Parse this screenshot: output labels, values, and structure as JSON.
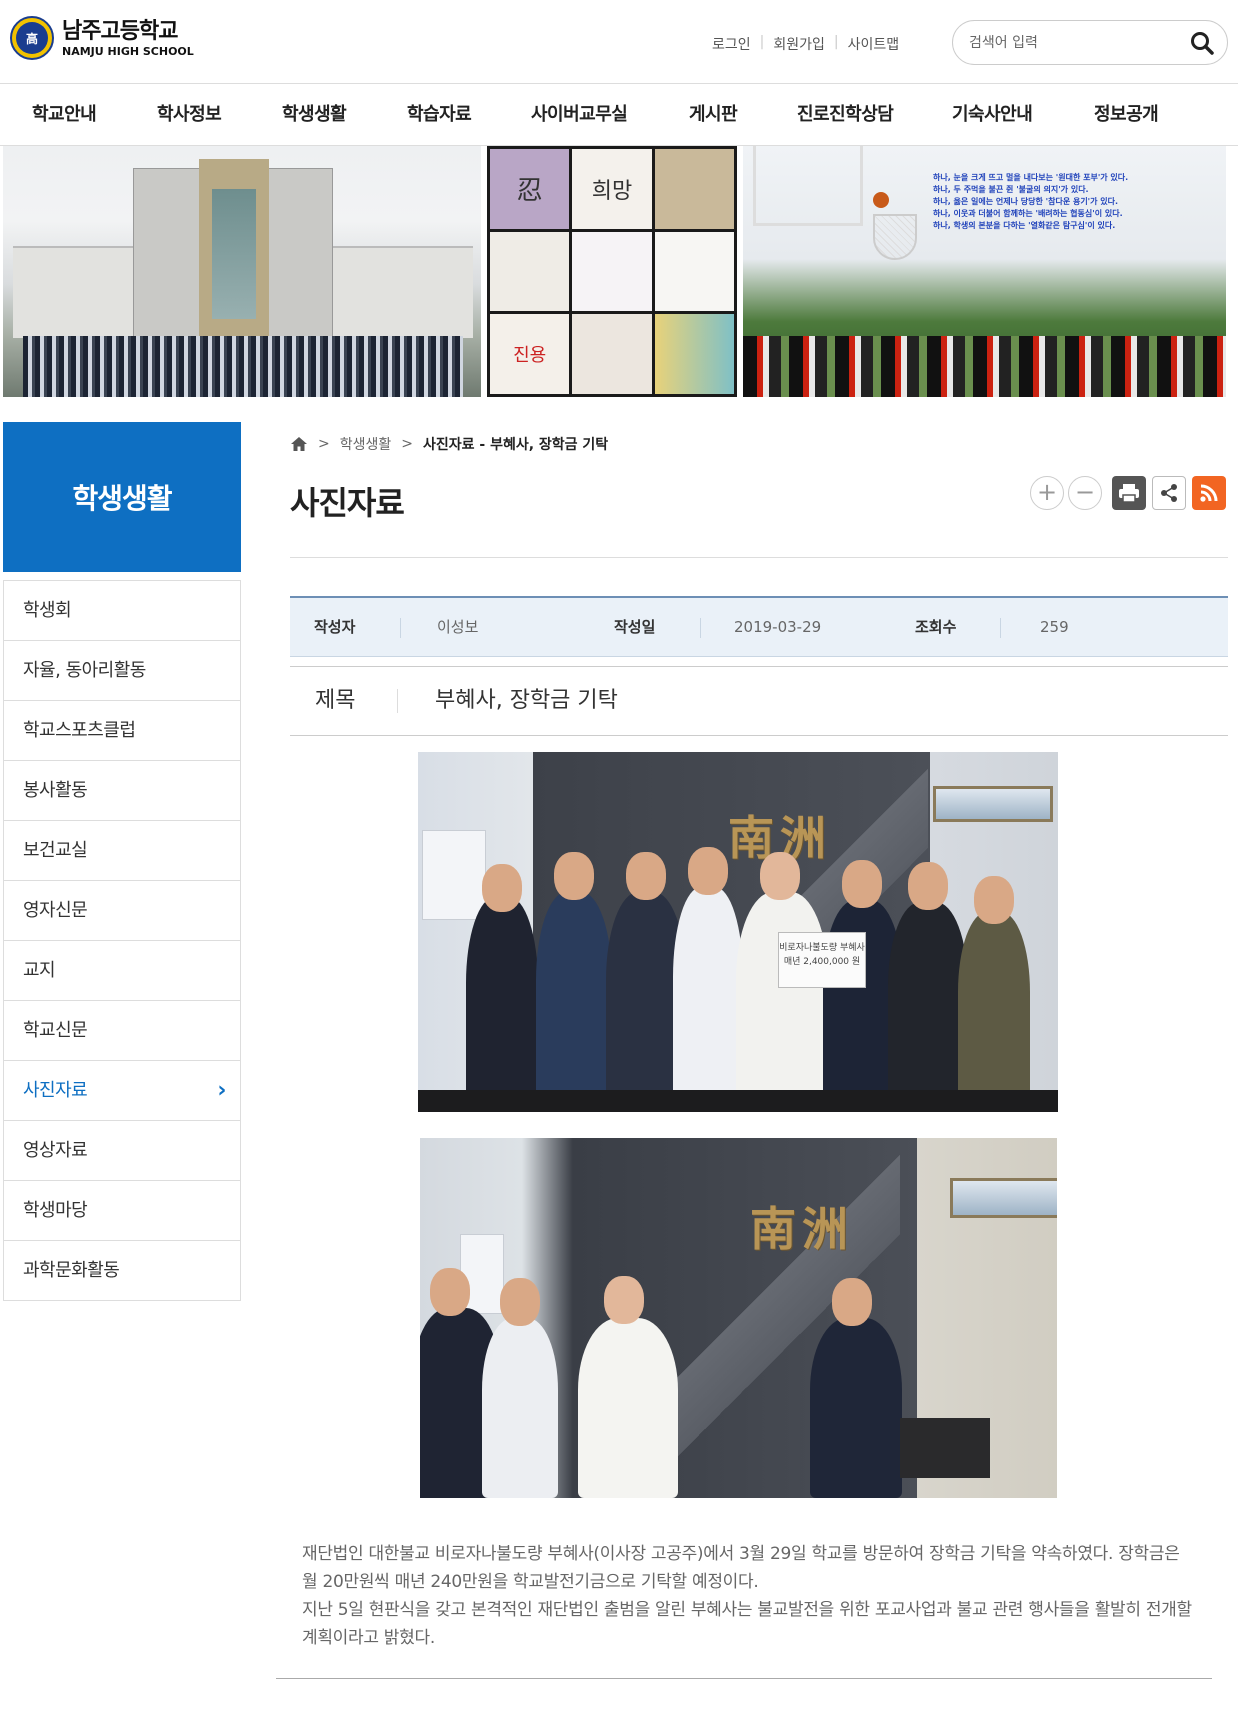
{
  "header": {
    "school_name": "남주고등학교",
    "school_name_en": "NAMJU HIGH SCHOOL",
    "emblem_text": "高",
    "util_links": [
      "로그인",
      "회원가입",
      "사이트맵"
    ],
    "search_placeholder": "검색어 입력"
  },
  "gnb": [
    "학교안내",
    "학사정보",
    "학생생활",
    "학습자료",
    "사이버교무실",
    "게시판",
    "진로진학상담",
    "기숙사안내",
    "정보공개"
  ],
  "banner": {
    "tiles": [
      "忍",
      "희망",
      "",
      "",
      "",
      "",
      "진용",
      "",
      ""
    ],
    "motto_lines": [
      "하나, 눈을 크게 뜨고 멀을 내다보는 '원대한 포부'가 있다.",
      "하나, 두 주먹을 불끈 쥔 '불굴의 의지'가 있다.",
      "하나, 옳은 일에는 언제나 당당한 '참다운 용기'가 있다.",
      "하나, 이웃과 더불어 함께하는 '배려하는 협동심'이 있다.",
      "하나, 학생의 본분을 다하는 '열화같은 탐구심'이 있다."
    ]
  },
  "sidebar": {
    "title": "학생생활",
    "items": [
      {
        "label": "학생회"
      },
      {
        "label": "자율, 동아리활동"
      },
      {
        "label": "학교스포츠클럽"
      },
      {
        "label": "봉사활동"
      },
      {
        "label": "보건교실"
      },
      {
        "label": "영자신문"
      },
      {
        "label": "교지"
      },
      {
        "label": "학교신문"
      },
      {
        "label": "사진자료"
      },
      {
        "label": "영상자료"
      },
      {
        "label": "학생마당"
      },
      {
        "label": "과학문화활동"
      }
    ],
    "active_index": 8
  },
  "breadcrumb": {
    "level1": "학생생활",
    "current": "사진자료 - 부혜사, 장학금 기탁"
  },
  "page_title": "사진자료",
  "post": {
    "author_label": "작성자",
    "author": "이성보",
    "date_label": "작성일",
    "date": "2019-03-29",
    "views_label": "조회수",
    "views": "259",
    "subject_label": "제목",
    "subject": "부혜사, 장학금 기탁",
    "photo1_sign": "南洲",
    "photo2_sign": "南洲",
    "check_text_1": "비로자나불도량 부혜사",
    "check_text_2": "매년 2,400,000 원",
    "body": "재단법인 대한불교 비로자나불도량 부혜사(이사장 고공주)에서 3월 29일 학교를 방문하여 장학금 기탁을 약속하였다. 장학금은 월 20만원씩 매년 240만원을 학교발전기금으로 기탁할 예정이다.\n지난 5일 현판식을 갖고 본격적인 재단법인 출범을 알린 부혜사는 불교발전을 위한 포교사업과 불교 관련 행사들을 활발히 전개할 계획이라고 밝혔다."
  },
  "colors": {
    "accent": "#0e6fc2",
    "rss": "#f26522",
    "print": "#555555"
  }
}
